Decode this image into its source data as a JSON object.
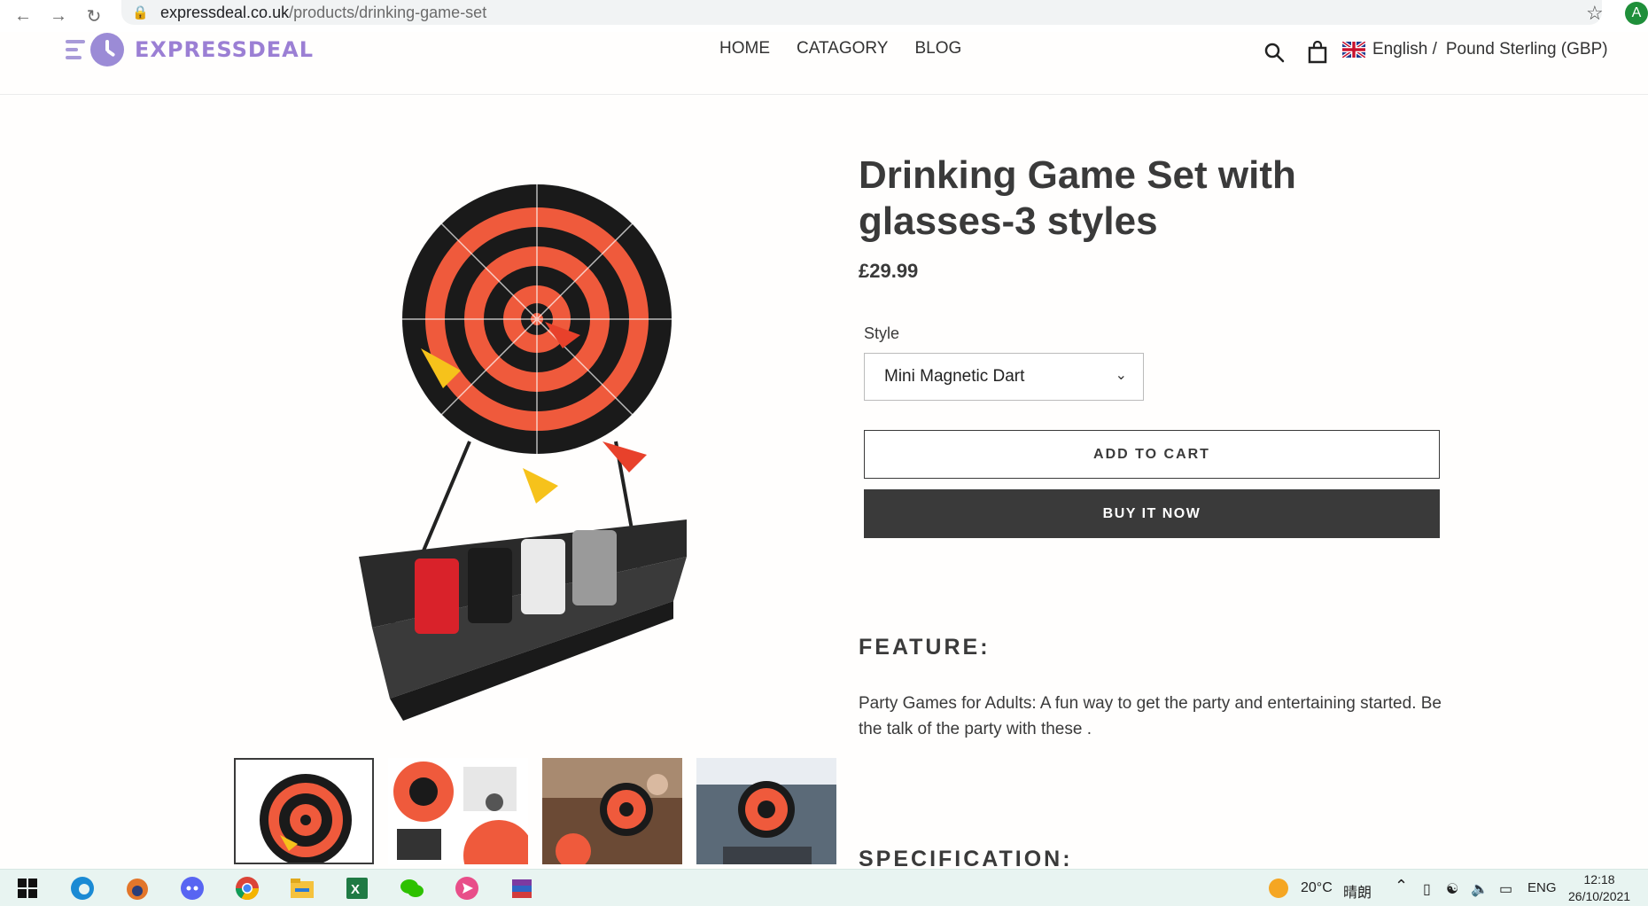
{
  "browser": {
    "url_host": "expressdeal.co.uk",
    "url_path": "/products/drinking-game-set",
    "profile_initial": "A",
    "back_icon": "arrow-left-icon",
    "forward_icon": "arrow-right-icon",
    "reload_icon": "reload-icon",
    "lock_icon": "lock-icon",
    "star_icon": "star-icon"
  },
  "header": {
    "logo_text": "EXPRESSDEAL",
    "nav": [
      "HOME",
      "CATAGORY",
      "BLOG"
    ],
    "language": "English /",
    "currency": "Pound Sterling (GBP)",
    "accent_color": "#9b7fd4"
  },
  "product": {
    "title": "Drinking Game Set with glasses-3 styles",
    "price": "£29.99",
    "style_label": "Style",
    "style_selected": "Mini Magnetic Dart",
    "add_to_cart": "ADD TO CART",
    "buy_now": "BUY IT NOW",
    "feature_heading": "FEATURE:",
    "feature_text": "Party Games for Adults: A fun way to get the party and entertaining started. Be the talk of the party with these .",
    "spec_heading": "SPECIFICATION:"
  },
  "taskbar": {
    "weather_temp": "20°C",
    "weather_desc": "晴朗",
    "language": "ENG",
    "time": "12:18",
    "date": "26/10/2021"
  }
}
